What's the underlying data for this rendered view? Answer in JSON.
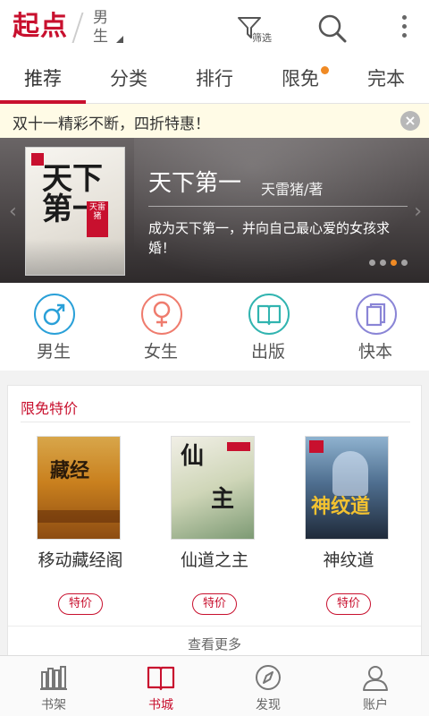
{
  "header": {
    "logo": "起点",
    "gender": "男生",
    "filter_label": "筛选"
  },
  "tabs": [
    {
      "label": "推荐",
      "active": true
    },
    {
      "label": "分类",
      "active": false
    },
    {
      "label": "排行",
      "active": false
    },
    {
      "label": "限免",
      "active": false,
      "badge": true
    },
    {
      "label": "完本",
      "active": false
    }
  ],
  "notice": {
    "text": "双十一精彩不断，四折特惠！"
  },
  "banner": {
    "title": "天下第一",
    "author": "天雷猪/著",
    "description": "成为天下第一，并向自己最心爱的女孩求婚！",
    "cover_title": "天下第一",
    "cover_seal": "天雷猪",
    "slides": 4,
    "active_slide": 3
  },
  "categories": [
    {
      "label": "男生",
      "icon": "male-icon",
      "color": "#2aa0d8"
    },
    {
      "label": "女生",
      "icon": "female-icon",
      "color": "#ef7c6e"
    },
    {
      "label": "出版",
      "icon": "book-icon",
      "color": "#31b4b0"
    },
    {
      "label": "快本",
      "icon": "stack-icon",
      "color": "#8a85d6"
    }
  ],
  "section": {
    "title": "限免特价",
    "books": [
      {
        "title": "移动藏经阁",
        "badge": "特价"
      },
      {
        "title": "仙道之主",
        "badge": "特价"
      },
      {
        "title": "神纹道",
        "badge": "特价"
      }
    ],
    "see_more": "查看更多"
  },
  "bottom_nav": [
    {
      "label": "书架",
      "icon": "bookshelf-icon",
      "active": false
    },
    {
      "label": "书城",
      "icon": "open-book-icon",
      "active": true
    },
    {
      "label": "发现",
      "icon": "compass-icon",
      "active": false
    },
    {
      "label": "账户",
      "icon": "person-icon",
      "active": false
    }
  ],
  "colors": {
    "brand": "#c8102e",
    "tab_badge": "#f08a24"
  }
}
